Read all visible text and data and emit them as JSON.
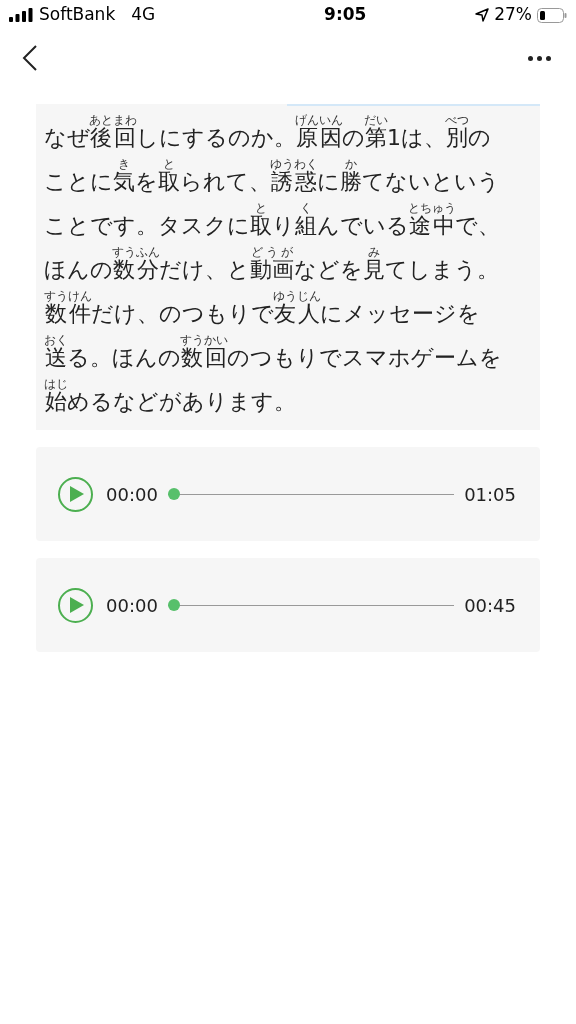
{
  "status_bar": {
    "carrier": "SoftBank",
    "network": "4G",
    "time": "9:05",
    "battery": "27%"
  },
  "article": {
    "lines": [
      [
        {
          "text": "なぜ"
        },
        {
          "text": "後回",
          "ruby": "あとまわ"
        },
        {
          "text": "しにするのか。"
        },
        {
          "text": "原因",
          "ruby": "げんいん"
        },
        {
          "text": "の"
        },
        {
          "text": "第",
          "ruby": "だい"
        },
        {
          "text": "1は、"
        },
        {
          "text": "別",
          "ruby": "べつ"
        },
        {
          "text": "の"
        }
      ],
      [
        {
          "text": "ことに"
        },
        {
          "text": "気",
          "ruby": "き"
        },
        {
          "text": "を"
        },
        {
          "text": "取",
          "ruby": "と"
        },
        {
          "text": "られて、"
        },
        {
          "text": "誘惑",
          "ruby": "ゆうわく"
        },
        {
          "text": "に"
        },
        {
          "text": "勝",
          "ruby": "か"
        },
        {
          "text": "てないという"
        }
      ],
      [
        {
          "text": "ことです。タスクに"
        },
        {
          "text": "取",
          "ruby": "と"
        },
        {
          "text": "り"
        },
        {
          "text": "組",
          "ruby": "く"
        },
        {
          "text": "んでいる"
        },
        {
          "text": "途中",
          "ruby": "とちゅう"
        },
        {
          "text": "で、"
        }
      ],
      [
        {
          "text": "ほんの"
        },
        {
          "text": "数分",
          "ruby": "すうふん"
        },
        {
          "text": "だけ、と"
        },
        {
          "text": "動画",
          "ruby": "どうが"
        },
        {
          "text": "などを"
        },
        {
          "text": "見",
          "ruby": "み"
        },
        {
          "text": "てしまう。"
        }
      ],
      [
        {
          "text": "数件",
          "ruby": "すうけん"
        },
        {
          "text": "だけ、のつもりで"
        },
        {
          "text": "友人",
          "ruby": "ゆうじん"
        },
        {
          "text": "にメッセージを"
        }
      ],
      [
        {
          "text": "送",
          "ruby": "おく"
        },
        {
          "text": "る。ほんの"
        },
        {
          "text": "数回",
          "ruby": "すうかい"
        },
        {
          "text": "のつもりでスマホゲームを"
        }
      ],
      [
        {
          "text": "始",
          "ruby": "はじ"
        },
        {
          "text": "めるなどがあります。"
        }
      ]
    ]
  },
  "audio_players": [
    {
      "current": "00:00",
      "duration": "01:05",
      "level": 0
    },
    {
      "current": "00:00",
      "duration": "00:45",
      "level": 0
    }
  ]
}
